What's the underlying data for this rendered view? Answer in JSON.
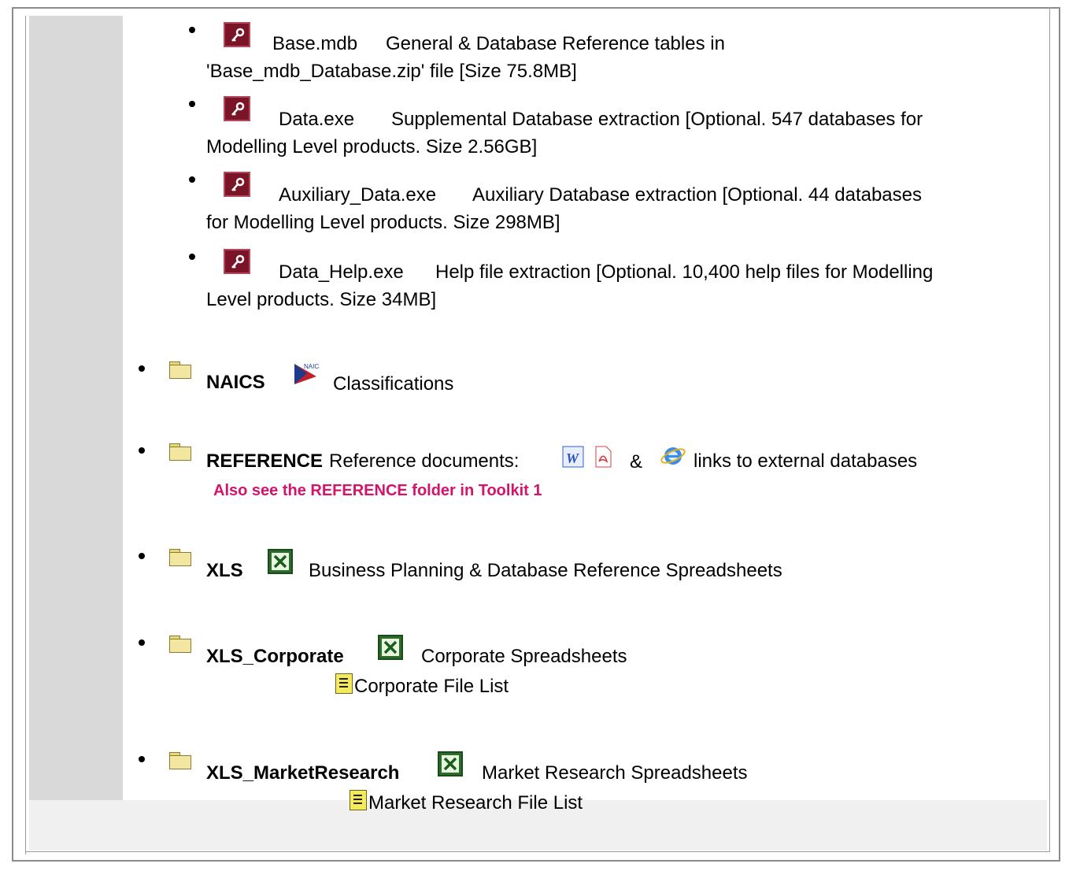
{
  "databases": [
    {
      "name": "Base.mdb",
      "desc_line1": "General & Database Reference tables in",
      "desc_line2": "'Base_mdb_Database.zip' file [Size 75.8MB]"
    },
    {
      "name": "Data.exe",
      "desc_line1": "Supplemental Database extraction [Optional. 547 databases for",
      "desc_line2": "Modelling Level products. Size 2.56GB]"
    },
    {
      "name": "Auxiliary_Data.exe",
      "desc_line1": "Auxiliary Database extraction [Optional. 44 databases",
      "desc_line2": "for Modelling Level products. Size 298MB]"
    },
    {
      "name": "Data_Help.exe",
      "desc_line1": "Help file extraction [Optional. 10,400 help files for Modelling",
      "desc_line2": "Level products. Size 34MB]"
    }
  ],
  "folders": {
    "naics": {
      "name": "NAICS",
      "desc": "Classifications",
      "logo_text": "NAICS"
    },
    "reference": {
      "name": "REFERENCE",
      "desc_pre": "Reference documents:",
      "desc_amp": "&",
      "desc_post": "links to external databases",
      "note": "Also see the REFERENCE folder in Toolkit 1"
    },
    "xls": {
      "name": "XLS",
      "desc": "Business Planning & Database Reference Spreadsheets"
    },
    "xls_corporate": {
      "name": "XLS_Corporate",
      "desc": "Corporate Spreadsheets",
      "file_list": "Corporate File List"
    },
    "xls_marketresearch": {
      "name": "XLS_MarketResearch",
      "desc": "Market Research Spreadsheets",
      "file_list": "Market Research File List"
    }
  },
  "colors": {
    "note_pink": "#d4136a",
    "access_red": "#7b1427",
    "excel_green": "#2d6b2d",
    "sidebar_gray": "#d9d9d9"
  }
}
